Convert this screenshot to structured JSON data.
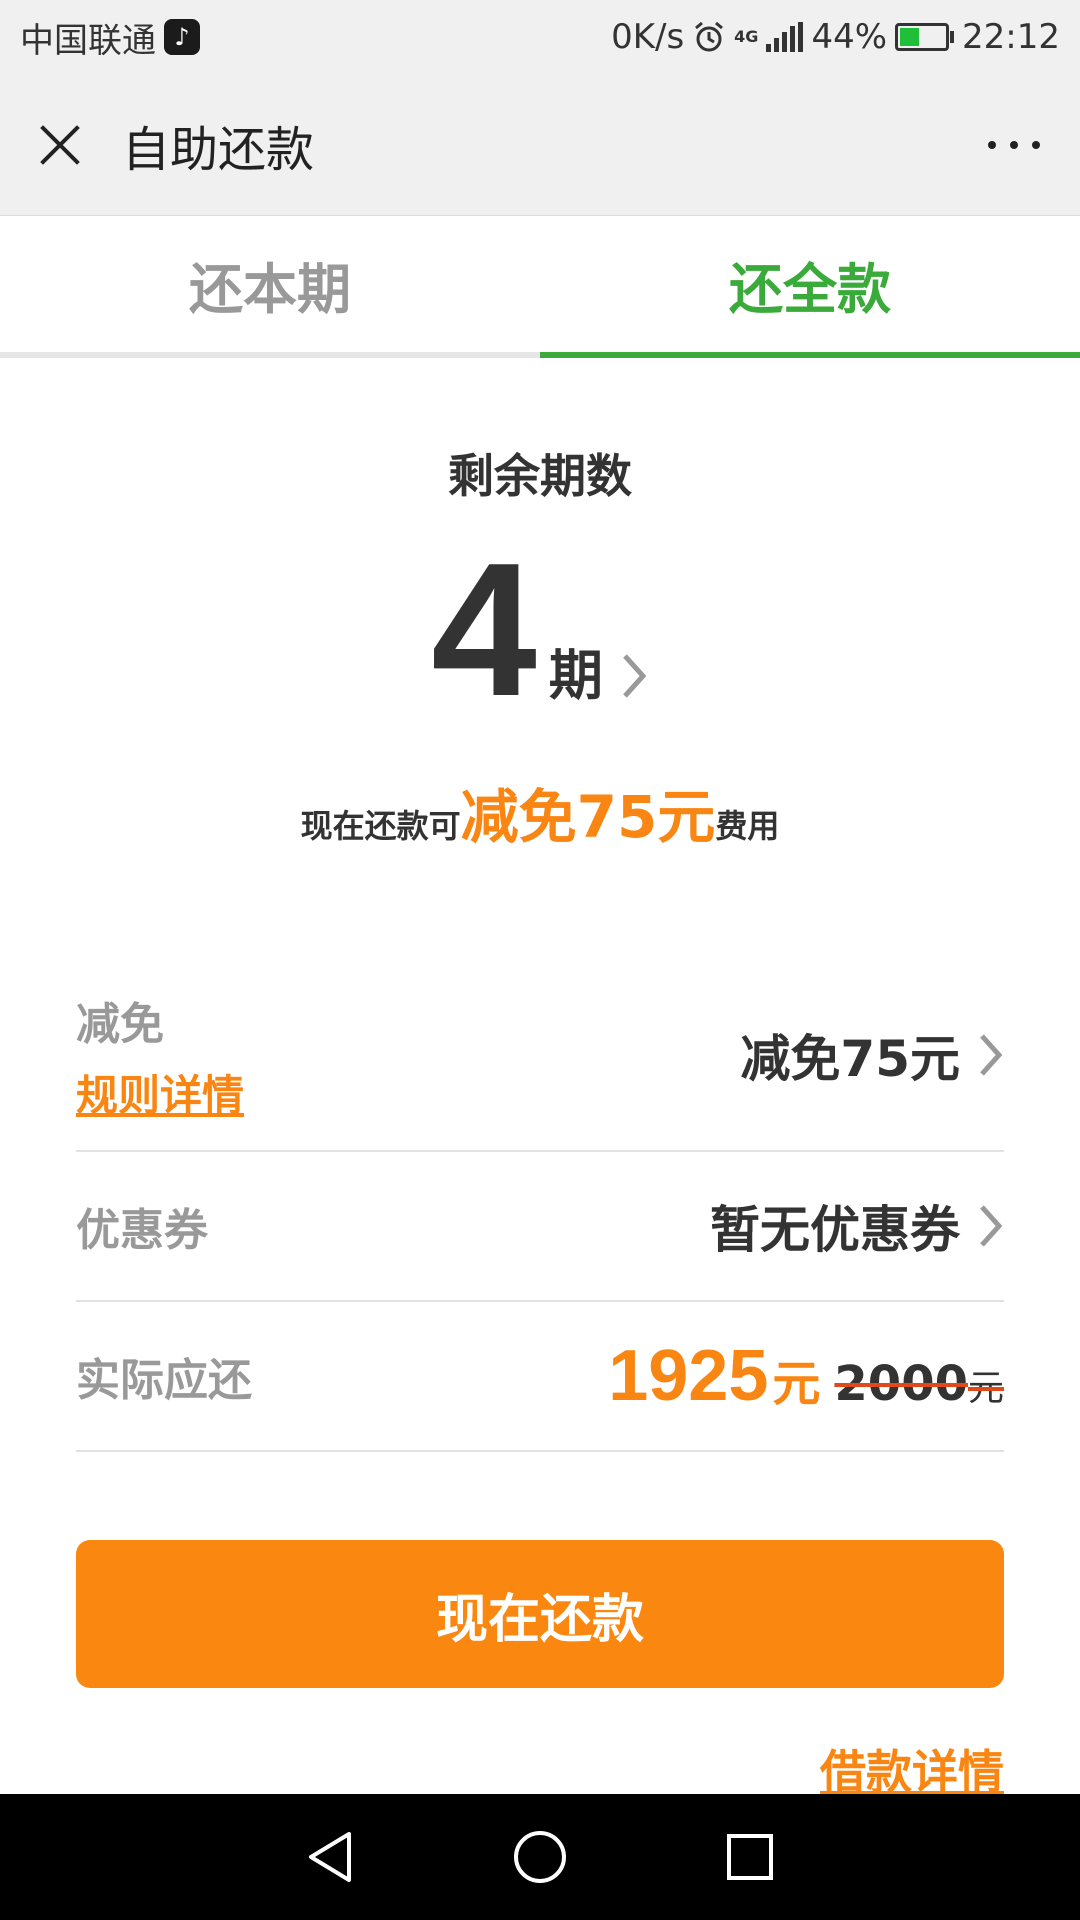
{
  "status_bar": {
    "carrier": "中国联通",
    "speed": "0K/s",
    "network": "4G",
    "battery": "44%",
    "time": "22:12"
  },
  "header": {
    "title": "自助还款",
    "close_icon": "close-icon",
    "more_icon": "more-icon"
  },
  "tabs": [
    {
      "label": "还本期",
      "active": false
    },
    {
      "label": "还全款",
      "active": true
    }
  ],
  "summary": {
    "remaining_label": "剩余期数",
    "periods": "4",
    "periods_unit": "期",
    "discount_prefix": "现在还款可",
    "discount_highlight": "减免75元",
    "discount_suffix": "费用"
  },
  "rows": {
    "reduction": {
      "label": "减免",
      "link": "规则详情",
      "value": "减免75元"
    },
    "coupon": {
      "label": "优惠券",
      "value": "暂无优惠券"
    },
    "actual": {
      "label": "实际应还",
      "amount": "1925",
      "amount_unit": "元",
      "original": "2000",
      "original_unit": "元"
    }
  },
  "pay_button": "现在还款",
  "loan_details_link": "借款详情",
  "colors": {
    "accent_orange": "#fa870f",
    "tab_active_green": "#3aaa3a"
  }
}
